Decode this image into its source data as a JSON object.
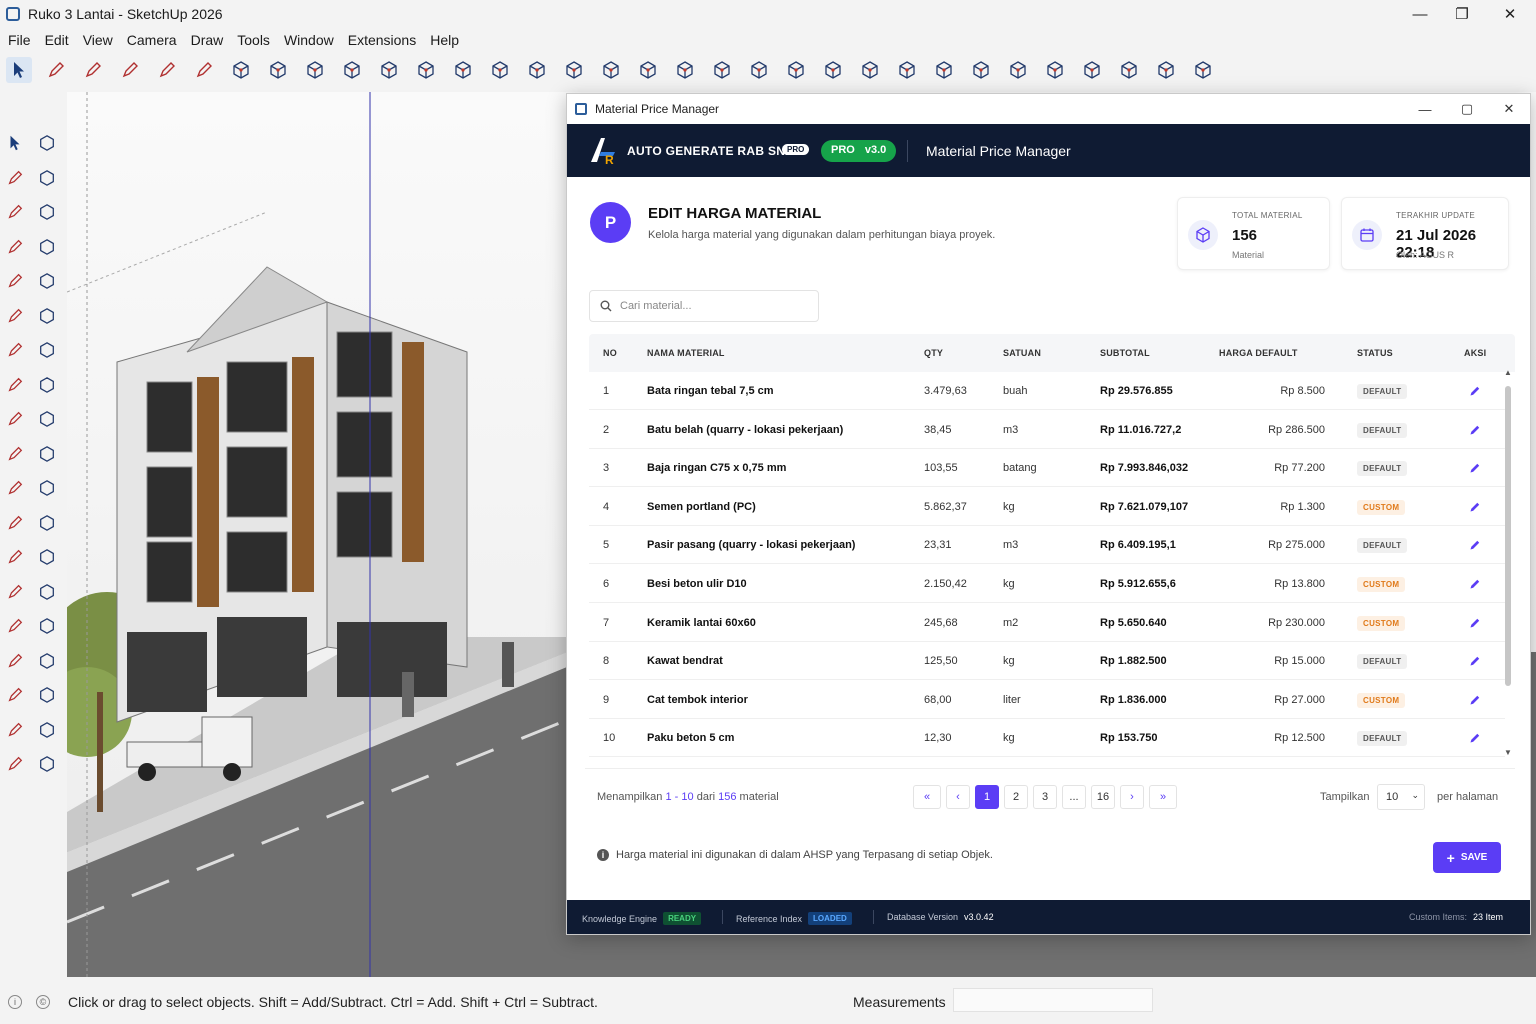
{
  "window": {
    "title": "Ruko 3 Lantai - SketchUp 2026",
    "minimize": "—",
    "maximize": "❐",
    "close": "✕"
  },
  "menu": [
    "File",
    "Edit",
    "View",
    "Camera",
    "Draw",
    "Tools",
    "Window",
    "Extensions",
    "Help"
  ],
  "status": {
    "hint": "Click or drag to select objects. Shift = Add/Subtract. Ctrl = Add. Shift + Ctrl = Subtract.",
    "measurements_label": "Measurements"
  },
  "dialog": {
    "title": "Material Price Manager",
    "brand": "AUTO GENERATE RAB SNI",
    "pro_badge": "PRO",
    "version_pro": "PRO",
    "version": "v3.0",
    "banner_title": "Material Price Manager",
    "avatar_letter": "P",
    "heading": "EDIT HARGA MATERIAL",
    "subheading": "Kelola harga material yang digunakan dalam perhitungan biaya proyek.",
    "stat_total": {
      "label": "TOTAL MATERIAL",
      "value": "156",
      "sub": "Material"
    },
    "stat_update": {
      "label": "TERAKHIR UPDATE",
      "value": "21 Jul 2026 22:18",
      "sub": "Oleh: AGUS R"
    },
    "search_placeholder": "Cari material...",
    "columns": [
      "NO",
      "NAMA MATERIAL",
      "QTY",
      "SATUAN",
      "SUBTOTAL",
      "HARGA DEFAULT",
      "STATUS",
      "AKSI"
    ],
    "rows": [
      {
        "no": "1",
        "name": "Bata ringan tebal 7,5 cm",
        "qty": "3.479,63",
        "unit": "buah",
        "subtotal": "Rp 29.576.855",
        "price": "Rp 8.500",
        "status": "DEFAULT"
      },
      {
        "no": "2",
        "name": "Batu belah (quarry - lokasi pekerjaan)",
        "qty": "38,45",
        "unit": "m3",
        "subtotal": "Rp 11.016.727,2",
        "price": "Rp 286.500",
        "status": "DEFAULT"
      },
      {
        "no": "3",
        "name": "Baja ringan C75 x 0,75 mm",
        "qty": "103,55",
        "unit": "batang",
        "subtotal": "Rp 7.993.846,032",
        "price": "Rp 77.200",
        "status": "DEFAULT"
      },
      {
        "no": "4",
        "name": "Semen portland (PC)",
        "qty": "5.862,37",
        "unit": "kg",
        "subtotal": "Rp 7.621.079,107",
        "price": "Rp 1.300",
        "status": "CUSTOM"
      },
      {
        "no": "5",
        "name": "Pasir pasang (quarry - lokasi pekerjaan)",
        "qty": "23,31",
        "unit": "m3",
        "subtotal": "Rp 6.409.195,1",
        "price": "Rp 275.000",
        "status": "DEFAULT"
      },
      {
        "no": "6",
        "name": "Besi beton ulir D10",
        "qty": "2.150,42",
        "unit": "kg",
        "subtotal": "Rp 5.912.655,6",
        "price": "Rp 13.800",
        "status": "CUSTOM"
      },
      {
        "no": "7",
        "name": "Keramik lantai 60x60",
        "qty": "245,68",
        "unit": "m2",
        "subtotal": "Rp 5.650.640",
        "price": "Rp 230.000",
        "status": "CUSTOM"
      },
      {
        "no": "8",
        "name": "Kawat bendrat",
        "qty": "125,50",
        "unit": "kg",
        "subtotal": "Rp 1.882.500",
        "price": "Rp 15.000",
        "status": "DEFAULT"
      },
      {
        "no": "9",
        "name": "Cat tembok interior",
        "qty": "68,00",
        "unit": "liter",
        "subtotal": "Rp 1.836.000",
        "price": "Rp 27.000",
        "status": "CUSTOM"
      },
      {
        "no": "10",
        "name": "Paku beton 5 cm",
        "qty": "12,30",
        "unit": "kg",
        "subtotal": "Rp 153.750",
        "price": "Rp 12.500",
        "status": "DEFAULT"
      }
    ],
    "pagination": {
      "showing_prefix": "Menampilkan",
      "from": "1",
      "dash": "-",
      "to": "10",
      "of": "dari",
      "total": "156",
      "suffix": "material",
      "pages": [
        "«",
        "‹",
        "1",
        "2",
        "3",
        "...",
        "16",
        "›",
        "»"
      ],
      "per_page_label": "Tampilkan",
      "per_page_value": "10",
      "per_page_suffix": "per halaman"
    },
    "note": "Harga material ini digunakan di dalam AHSP yang Terpasang di setiap Objek.",
    "save_label": "SAVE",
    "footer": {
      "engine_label": "Knowledge Engine",
      "engine_status": "READY",
      "index_label": "Reference Index",
      "index_status": "LOADED",
      "db_label": "Database Version",
      "db_value": "v3.0.42",
      "custom_label": "Custom Items:",
      "custom_value": "23 Item"
    }
  },
  "colors": {
    "accent": "#5b3df5",
    "banner": "#0f1b33",
    "ready": "#16a34a",
    "custom": "#e07a1a"
  }
}
